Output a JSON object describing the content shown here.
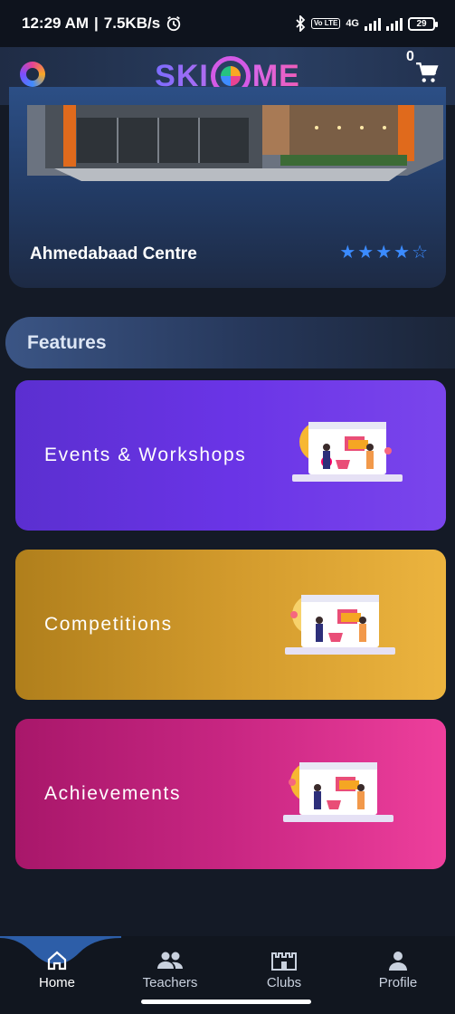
{
  "status_bar": {
    "time": "12:29 AM",
    "net_speed": "7.5KB/s",
    "volte": "Vo LTE",
    "network": "4G",
    "battery": "29"
  },
  "header": {
    "brand_left": "SKI",
    "brand_right": "ME",
    "cart_count": "0"
  },
  "centre": {
    "name": "Ahmedabaad Centre",
    "rating": 4,
    "rating_max": 5
  },
  "features": {
    "heading": "Features",
    "cards": [
      {
        "label": "Events & Workshops",
        "color": "#6a34e6"
      },
      {
        "label": "Competitions",
        "color": "#d29a2c"
      },
      {
        "label": "Achievements",
        "color": "#c82682"
      }
    ]
  },
  "nav": {
    "items": [
      {
        "label": "Home",
        "icon": "home-icon",
        "active": true
      },
      {
        "label": "Teachers",
        "icon": "teachers-icon",
        "active": false
      },
      {
        "label": "Clubs",
        "icon": "clubs-icon",
        "active": false
      },
      {
        "label": "Profile",
        "icon": "profile-icon",
        "active": false
      }
    ]
  },
  "colors": {
    "background": "#141a26",
    "accent_blue": "#3b8bff",
    "nav_active": "#2d5ea8"
  }
}
